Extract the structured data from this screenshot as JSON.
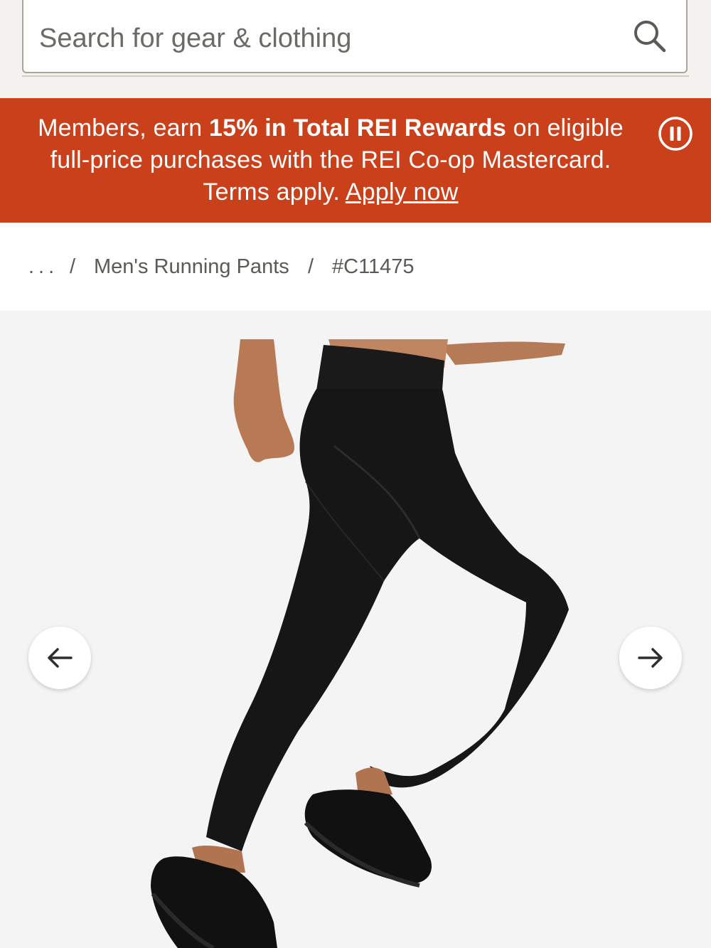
{
  "search": {
    "placeholder": "Search for gear & clothing"
  },
  "promo": {
    "text_start": "Members, earn ",
    "text_bold": "15% in Total REI Rewards",
    "text_mid": " on eligible full-price purchases with the REI Co-op Mastercard. Terms apply. ",
    "link_label": "Apply now",
    "background_color": "#c9401b"
  },
  "breadcrumb": {
    "ellipsis": "...",
    "separator": "/",
    "items": [
      "Men's Running Pants",
      "#C11475"
    ]
  },
  "gallery": {
    "image_alt": "Runner wearing black running pants and black shoes",
    "prev_icon": "arrow-left-icon",
    "next_icon": "arrow-right-icon"
  }
}
